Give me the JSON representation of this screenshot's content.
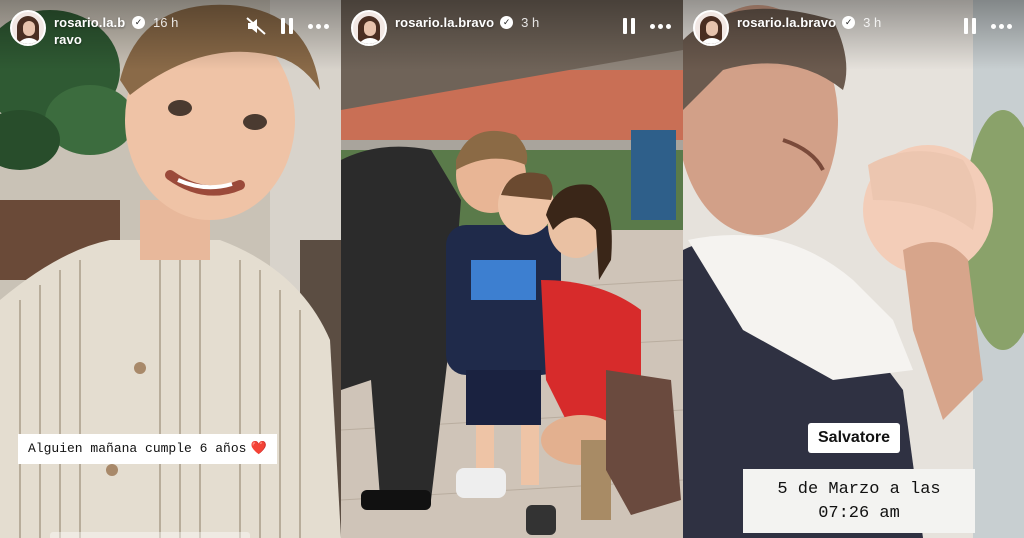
{
  "stories": [
    {
      "username": "rosario.la.bravo",
      "time": "16 h",
      "caption": "Alguien mañana cumple 6 años",
      "caption_emoji": "❤️"
    },
    {
      "username": "rosario.la.bravo",
      "time": "3 h"
    },
    {
      "username": "rosario.la.bravo",
      "time": "3 h",
      "name_label": "Salvatore",
      "date_line1": "5 de Marzo a las",
      "date_line2": "07:26 am"
    }
  ],
  "icons": [
    "verified-icon",
    "mute-icon",
    "pause-icon",
    "more-icon"
  ]
}
